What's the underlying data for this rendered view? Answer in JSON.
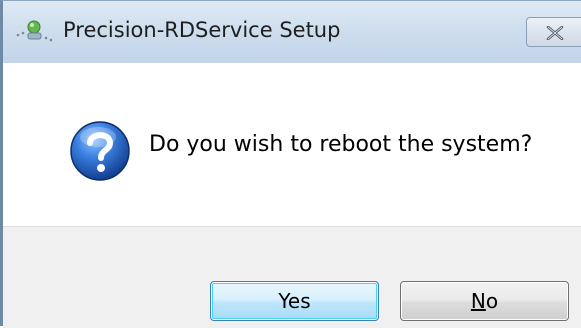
{
  "window": {
    "title": "Precision-RDService Setup",
    "app_icon": "installer-icon",
    "close_icon": "close-icon"
  },
  "dialog": {
    "icon": "question-icon",
    "message": "Do you wish to reboot the system?"
  },
  "buttons": {
    "yes_label": "Yes",
    "no_mnemonic": "N",
    "no_rest": "o"
  },
  "colors": {
    "titlebar": "#cfdeee",
    "footer": "#f0f0f0",
    "default_button_border": "#3c7fb1",
    "question_icon": "#2a63c4"
  }
}
